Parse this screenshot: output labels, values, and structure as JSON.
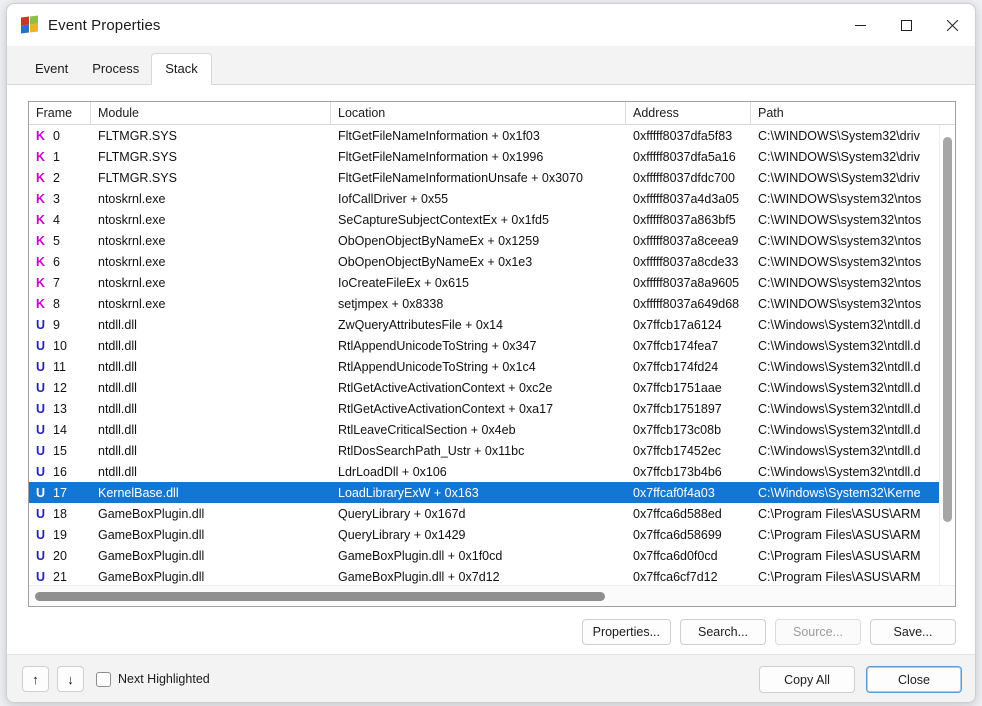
{
  "window": {
    "title": "Event Properties",
    "app_icon": "procmon-icon",
    "minimize_label": "—",
    "maximize_label": "☐",
    "close_label": "✕"
  },
  "tabs": [
    {
      "label": "Event",
      "active": false
    },
    {
      "label": "Process",
      "active": false
    },
    {
      "label": "Stack",
      "active": true
    }
  ],
  "table": {
    "columns": [
      "Frame",
      "Module",
      "Location",
      "Address",
      "Path"
    ],
    "rows": [
      {
        "kind": "K",
        "frame": "0",
        "module": "FLTMGR.SYS",
        "location": "FltGetFileNameInformation + 0x1f03",
        "address": "0xfffff8037dfa5f83",
        "path": "C:\\WINDOWS\\System32\\driv",
        "selected": false
      },
      {
        "kind": "K",
        "frame": "1",
        "module": "FLTMGR.SYS",
        "location": "FltGetFileNameInformation + 0x1996",
        "address": "0xfffff8037dfa5a16",
        "path": "C:\\WINDOWS\\System32\\driv",
        "selected": false
      },
      {
        "kind": "K",
        "frame": "2",
        "module": "FLTMGR.SYS",
        "location": "FltGetFileNameInformationUnsafe + 0x3070",
        "address": "0xfffff8037dfdc700",
        "path": "C:\\WINDOWS\\System32\\driv",
        "selected": false
      },
      {
        "kind": "K",
        "frame": "3",
        "module": "ntoskrnl.exe",
        "location": "IofCallDriver + 0x55",
        "address": "0xfffff8037a4d3a05",
        "path": "C:\\WINDOWS\\system32\\ntos",
        "selected": false
      },
      {
        "kind": "K",
        "frame": "4",
        "module": "ntoskrnl.exe",
        "location": "SeCaptureSubjectContextEx + 0x1fd5",
        "address": "0xfffff8037a863bf5",
        "path": "C:\\WINDOWS\\system32\\ntos",
        "selected": false
      },
      {
        "kind": "K",
        "frame": "5",
        "module": "ntoskrnl.exe",
        "location": "ObOpenObjectByNameEx + 0x1259",
        "address": "0xfffff8037a8ceea9",
        "path": "C:\\WINDOWS\\system32\\ntos",
        "selected": false
      },
      {
        "kind": "K",
        "frame": "6",
        "module": "ntoskrnl.exe",
        "location": "ObOpenObjectByNameEx + 0x1e3",
        "address": "0xfffff8037a8cde33",
        "path": "C:\\WINDOWS\\system32\\ntos",
        "selected": false
      },
      {
        "kind": "K",
        "frame": "7",
        "module": "ntoskrnl.exe",
        "location": "IoCreateFileEx + 0x615",
        "address": "0xfffff8037a8a9605",
        "path": "C:\\WINDOWS\\system32\\ntos",
        "selected": false
      },
      {
        "kind": "K",
        "frame": "8",
        "module": "ntoskrnl.exe",
        "location": "setjmpex + 0x8338",
        "address": "0xfffff8037a649d68",
        "path": "C:\\WINDOWS\\system32\\ntos",
        "selected": false
      },
      {
        "kind": "U",
        "frame": "9",
        "module": "ntdll.dll",
        "location": "ZwQueryAttributesFile + 0x14",
        "address": "0x7ffcb17a6124",
        "path": "C:\\Windows\\System32\\ntdll.d",
        "selected": false
      },
      {
        "kind": "U",
        "frame": "10",
        "module": "ntdll.dll",
        "location": "RtlAppendUnicodeToString + 0x347",
        "address": "0x7ffcb174fea7",
        "path": "C:\\Windows\\System32\\ntdll.d",
        "selected": false
      },
      {
        "kind": "U",
        "frame": "11",
        "module": "ntdll.dll",
        "location": "RtlAppendUnicodeToString + 0x1c4",
        "address": "0x7ffcb174fd24",
        "path": "C:\\Windows\\System32\\ntdll.d",
        "selected": false
      },
      {
        "kind": "U",
        "frame": "12",
        "module": "ntdll.dll",
        "location": "RtlGetActiveActivationContext + 0xc2e",
        "address": "0x7ffcb1751aae",
        "path": "C:\\Windows\\System32\\ntdll.d",
        "selected": false
      },
      {
        "kind": "U",
        "frame": "13",
        "module": "ntdll.dll",
        "location": "RtlGetActiveActivationContext + 0xa17",
        "address": "0x7ffcb1751897",
        "path": "C:\\Windows\\System32\\ntdll.d",
        "selected": false
      },
      {
        "kind": "U",
        "frame": "14",
        "module": "ntdll.dll",
        "location": "RtlLeaveCriticalSection + 0x4eb",
        "address": "0x7ffcb173c08b",
        "path": "C:\\Windows\\System32\\ntdll.d",
        "selected": false
      },
      {
        "kind": "U",
        "frame": "15",
        "module": "ntdll.dll",
        "location": "RtlDosSearchPath_Ustr + 0x11bc",
        "address": "0x7ffcb17452ec",
        "path": "C:\\Windows\\System32\\ntdll.d",
        "selected": false
      },
      {
        "kind": "U",
        "frame": "16",
        "module": "ntdll.dll",
        "location": "LdrLoadDll + 0x106",
        "address": "0x7ffcb173b4b6",
        "path": "C:\\Windows\\System32\\ntdll.d",
        "selected": false
      },
      {
        "kind": "U",
        "frame": "17",
        "module": "KernelBase.dll",
        "location": "LoadLibraryExW + 0x163",
        "address": "0x7ffcaf0f4a03",
        "path": "C:\\Windows\\System32\\Kerne",
        "selected": true
      },
      {
        "kind": "U",
        "frame": "18",
        "module": "GameBoxPlugin.dll",
        "location": "QueryLibrary + 0x167d",
        "address": "0x7ffca6d588ed",
        "path": "C:\\Program Files\\ASUS\\ARM",
        "selected": false
      },
      {
        "kind": "U",
        "frame": "19",
        "module": "GameBoxPlugin.dll",
        "location": "QueryLibrary + 0x1429",
        "address": "0x7ffca6d58699",
        "path": "C:\\Program Files\\ASUS\\ARM",
        "selected": false
      },
      {
        "kind": "U",
        "frame": "20",
        "module": "GameBoxPlugin.dll",
        "location": "GameBoxPlugin.dll + 0x1f0cd",
        "address": "0x7ffca6d0f0cd",
        "path": "C:\\Program Files\\ASUS\\ARM",
        "selected": false
      },
      {
        "kind": "U",
        "frame": "21",
        "module": "GameBoxPlugin.dll",
        "location": "GameBoxPlugin.dll + 0x7d12",
        "address": "0x7ffca6cf7d12",
        "path": "C:\\Program Files\\ASUS\\ARM",
        "selected": false
      }
    ]
  },
  "mid_buttons": [
    {
      "label": "Properties...",
      "disabled": false
    },
    {
      "label": "Search...",
      "disabled": false
    },
    {
      "label": "Source...",
      "disabled": true
    },
    {
      "label": "Save...",
      "disabled": false
    }
  ],
  "footer": {
    "up_arrow": "↑",
    "down_arrow": "↓",
    "checkbox_label": "Next Highlighted",
    "checkbox_checked": false,
    "copy_all_label": "Copy All",
    "close_label": "Close"
  },
  "colors": {
    "selection": "#1277d4",
    "kernel_marker": "#cf00cf",
    "user_marker": "#2222c0",
    "default_button_border": "#5b9bd5"
  }
}
